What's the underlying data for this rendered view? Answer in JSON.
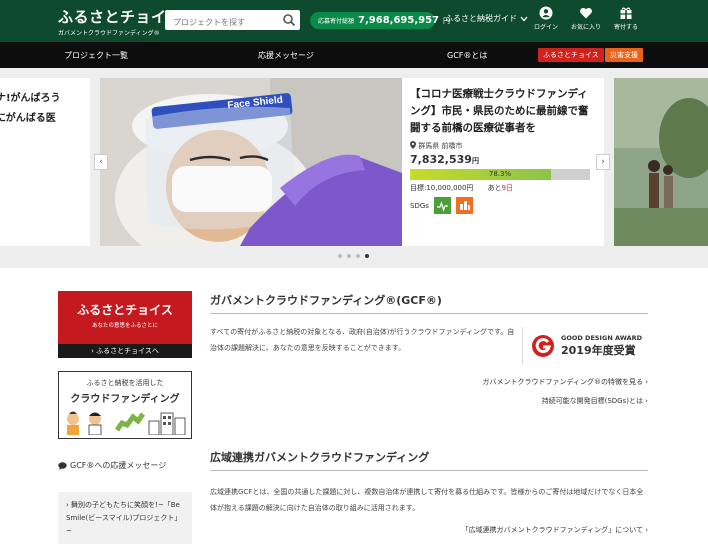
{
  "header": {
    "logo_main": "ふるさとチョイス",
    "logo_sub": "ガバメントクラウドファンディング®",
    "search_placeholder": "プロジェクトを探す",
    "total_label": "応募寄付総額",
    "total_amount": "7,968,695,957",
    "total_unit": "円",
    "guide": "ふるさと納税ガイド",
    "icons": [
      {
        "name": "user-icon",
        "label": "ログイン"
      },
      {
        "name": "heart-icon",
        "label": "お気に入り"
      },
      {
        "name": "gift-icon",
        "label": "寄付する"
      }
    ]
  },
  "nav": {
    "items": [
      "プロジェクト一覧",
      "応援メッセージ",
      "GCF®とは"
    ],
    "tag_choice": "ふるさとチョイス",
    "tag_disaster": "災害支援",
    "tag_choice_color": "#d0211c",
    "tag_disaster_color": "#e8641b"
  },
  "carousel": {
    "left_peek": [
      "ナ!がんばろう",
      "にがんばる医"
    ],
    "image_text": "Face Shield",
    "title": "【コロナ医療戦士クラウドファンディング】市民・県民のために最前線で奮闘する前橋の医療従事者を",
    "location": "群馬県 前橋市",
    "current": "7,832,539",
    "current_unit": "円",
    "progress_pct": "78.3%",
    "progress_value": 78.3,
    "goal": "目標:10,000,000円",
    "remaining_prefix": "あと",
    "remaining": "9日",
    "sdgs_label": "SDGs",
    "prev": "‹",
    "next": "›",
    "dots": 4,
    "active_dot": 3
  },
  "sidebar": {
    "banner1_title": "ふるさとチョイス",
    "banner1_sub": "あなたの意思をふるさとに",
    "banner1_link": "› ふるさとチョイスへ",
    "banner2_line1": "ふるさと納税を活用した",
    "banner2_line2": "クラウドファンディング",
    "msg_heading": "GCF®への応援メッセージ",
    "msg_text": "› 舞別の子どもたちに笑顔を!~「Be Smile(ビースマイル)プロジェクト」~"
  },
  "main": {
    "gcf_title": "ガバメントクラウドファンディング®(GCF®)",
    "gcf_desc": "すべての寄付がふるさと納税の対象となる、政府(自治体)が行うクラウドファンディングです。自治体の課題解決に、あなたの意思を反映することができます。",
    "gda_title": "GOOD DESIGN AWARD",
    "gda_year": "2019年度受賞",
    "link1": "ガバメントクラウドファンディング®の特徴を見る ›",
    "link2": "持続可能な開発目標(SDGs)とは ›",
    "regional_title": "広域連携ガバメントクラウドファンディング",
    "regional_desc": "広域連携GCFとは、全国の共通した課題に対し、複数自治体が連携して寄付を募る仕組みです。皆様からのご寄付は地域だけでなく日本全体が抱える課題の解決に向けた自治体の取り組みに活用されます。",
    "link3": "「広域連携ガバメントクラウドファンディング」について ›"
  }
}
